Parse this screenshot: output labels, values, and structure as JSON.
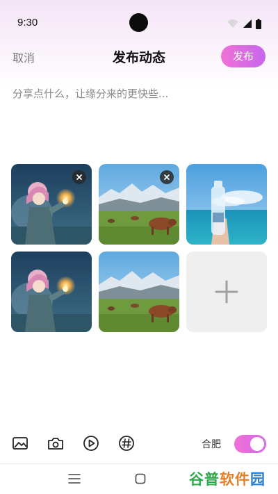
{
  "status_bar": {
    "time": "9:30"
  },
  "header": {
    "cancel_label": "取消",
    "title": "发布动态",
    "publish_label": "发布"
  },
  "composer": {
    "placeholder": "分享点什么，让缘分来的更快些..."
  },
  "images": [
    {
      "kind": "anime-girl-sparkler",
      "removable": true
    },
    {
      "kind": "cows-mountain-meadow",
      "removable": true
    },
    {
      "kind": "water-bottle-sea",
      "removable": false
    },
    {
      "kind": "anime-girl-sparkler",
      "removable": false
    },
    {
      "kind": "cows-mountain-meadow",
      "removable": false
    }
  ],
  "add_tile": {
    "icon": "plus-icon"
  },
  "toolbar": {
    "icons": [
      "image-icon",
      "camera-icon",
      "play-icon",
      "hashtag-icon"
    ],
    "visibility_label": "合肥",
    "toggle_on": true
  },
  "nav": {
    "icons": [
      "menu-icon",
      "home-icon"
    ]
  },
  "watermark": {
    "part1": "谷普",
    "part2": "软件",
    "part3": "园"
  },
  "colors": {
    "accent_start": "#f071d6",
    "accent_end": "#c766ee",
    "cancel_text": "#777777",
    "placeholder_text": "#888888"
  }
}
